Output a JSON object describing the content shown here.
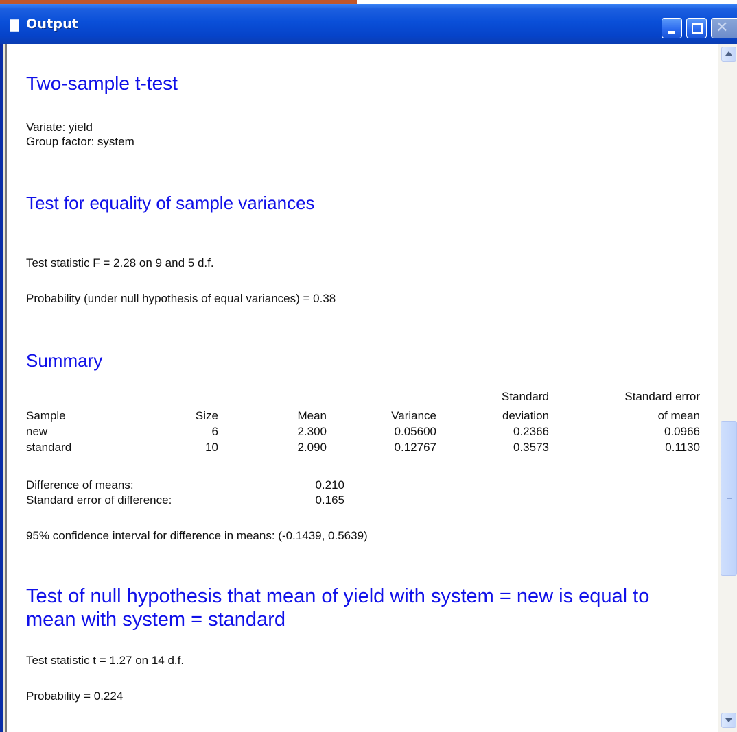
{
  "window": {
    "title": "Output",
    "buttons": {
      "minimize": "minimize",
      "maximize": "maximize",
      "close": "close"
    }
  },
  "content": {
    "heading1": "Two-sample t-test",
    "variate": "Variate: yield",
    "group_factor": "Group factor: system",
    "heading2": "Test for equality of sample variances",
    "f_statistic": "Test statistic F = 2.28 on 9 and 5 d.f.",
    "f_probability": "Probability (under null hypothesis of equal variances) = 0.38",
    "heading3": "Summary",
    "table": {
      "header_row1": [
        "",
        "",
        "",
        "",
        "Standard",
        "Standard error"
      ],
      "header_row2": [
        "Sample",
        "Size",
        "Mean",
        "Variance",
        "deviation",
        "of mean"
      ],
      "rows": [
        [
          "new",
          "6",
          "2.300",
          "0.05600",
          "0.2366",
          "0.0966"
        ],
        [
          "standard",
          "10",
          "2.090",
          "0.12767",
          "0.3573",
          "0.1130"
        ]
      ]
    },
    "diff_means_label": "Difference of means:",
    "diff_means_value": "0.210",
    "se_diff_label": "Standard error of difference:",
    "se_diff_value": "0.165",
    "confidence_interval": "95% confidence interval for difference in means: (-0.1439, 0.5639)",
    "heading4_line1": "Test of null hypothesis that mean of yield with system = new is equal to",
    "heading4_line2": "mean with system = standard",
    "t_statistic": "Test statistic t = 1.27 on 14 d.f.",
    "t_probability": "Probability = 0.224"
  },
  "scrollbar": {
    "position_fraction": 0.55
  }
}
